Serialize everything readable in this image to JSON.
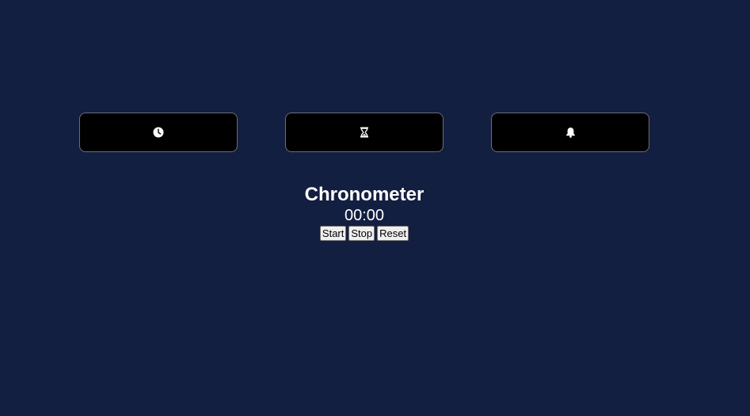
{
  "modes": [
    {
      "name": "clock",
      "icon": "clock-icon"
    },
    {
      "name": "timer",
      "icon": "hourglass-icon"
    },
    {
      "name": "alarm",
      "icon": "bell-icon"
    }
  ],
  "chronometer": {
    "title": "Chronometer",
    "display": "00:00",
    "start_label": "Start",
    "stop_label": "Stop",
    "reset_label": "Reset"
  },
  "colors": {
    "background": "#131f40",
    "mode_button": "#000000",
    "text": "#ffffff"
  }
}
